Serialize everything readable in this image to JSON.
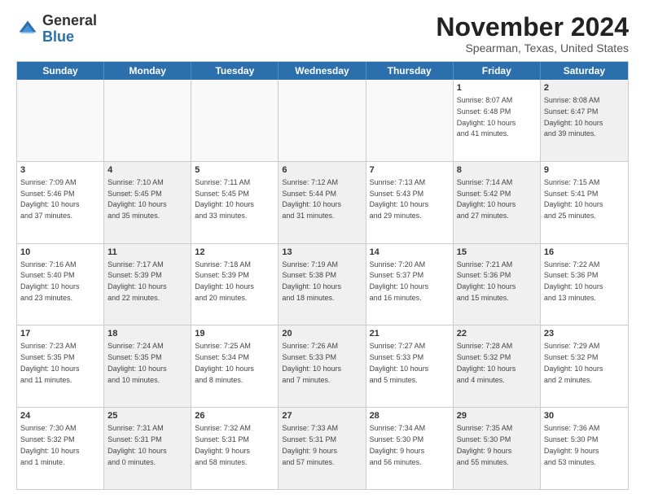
{
  "logo": {
    "line1": "General",
    "line2": "Blue"
  },
  "title": "November 2024",
  "location": "Spearman, Texas, United States",
  "header_days": [
    "Sunday",
    "Monday",
    "Tuesday",
    "Wednesday",
    "Thursday",
    "Friday",
    "Saturday"
  ],
  "weeks": [
    [
      {
        "day": "",
        "info": "",
        "shaded": false,
        "empty": true
      },
      {
        "day": "",
        "info": "",
        "shaded": false,
        "empty": true
      },
      {
        "day": "",
        "info": "",
        "shaded": false,
        "empty": true
      },
      {
        "day": "",
        "info": "",
        "shaded": false,
        "empty": true
      },
      {
        "day": "",
        "info": "",
        "shaded": false,
        "empty": true
      },
      {
        "day": "1",
        "info": "Sunrise: 8:07 AM\nSunset: 6:48 PM\nDaylight: 10 hours\nand 41 minutes.",
        "shaded": false,
        "empty": false
      },
      {
        "day": "2",
        "info": "Sunrise: 8:08 AM\nSunset: 6:47 PM\nDaylight: 10 hours\nand 39 minutes.",
        "shaded": true,
        "empty": false
      }
    ],
    [
      {
        "day": "3",
        "info": "Sunrise: 7:09 AM\nSunset: 5:46 PM\nDaylight: 10 hours\nand 37 minutes.",
        "shaded": false,
        "empty": false
      },
      {
        "day": "4",
        "info": "Sunrise: 7:10 AM\nSunset: 5:45 PM\nDaylight: 10 hours\nand 35 minutes.",
        "shaded": true,
        "empty": false
      },
      {
        "day": "5",
        "info": "Sunrise: 7:11 AM\nSunset: 5:45 PM\nDaylight: 10 hours\nand 33 minutes.",
        "shaded": false,
        "empty": false
      },
      {
        "day": "6",
        "info": "Sunrise: 7:12 AM\nSunset: 5:44 PM\nDaylight: 10 hours\nand 31 minutes.",
        "shaded": true,
        "empty": false
      },
      {
        "day": "7",
        "info": "Sunrise: 7:13 AM\nSunset: 5:43 PM\nDaylight: 10 hours\nand 29 minutes.",
        "shaded": false,
        "empty": false
      },
      {
        "day": "8",
        "info": "Sunrise: 7:14 AM\nSunset: 5:42 PM\nDaylight: 10 hours\nand 27 minutes.",
        "shaded": true,
        "empty": false
      },
      {
        "day": "9",
        "info": "Sunrise: 7:15 AM\nSunset: 5:41 PM\nDaylight: 10 hours\nand 25 minutes.",
        "shaded": false,
        "empty": false
      }
    ],
    [
      {
        "day": "10",
        "info": "Sunrise: 7:16 AM\nSunset: 5:40 PM\nDaylight: 10 hours\nand 23 minutes.",
        "shaded": false,
        "empty": false
      },
      {
        "day": "11",
        "info": "Sunrise: 7:17 AM\nSunset: 5:39 PM\nDaylight: 10 hours\nand 22 minutes.",
        "shaded": true,
        "empty": false
      },
      {
        "day": "12",
        "info": "Sunrise: 7:18 AM\nSunset: 5:39 PM\nDaylight: 10 hours\nand 20 minutes.",
        "shaded": false,
        "empty": false
      },
      {
        "day": "13",
        "info": "Sunrise: 7:19 AM\nSunset: 5:38 PM\nDaylight: 10 hours\nand 18 minutes.",
        "shaded": true,
        "empty": false
      },
      {
        "day": "14",
        "info": "Sunrise: 7:20 AM\nSunset: 5:37 PM\nDaylight: 10 hours\nand 16 minutes.",
        "shaded": false,
        "empty": false
      },
      {
        "day": "15",
        "info": "Sunrise: 7:21 AM\nSunset: 5:36 PM\nDaylight: 10 hours\nand 15 minutes.",
        "shaded": true,
        "empty": false
      },
      {
        "day": "16",
        "info": "Sunrise: 7:22 AM\nSunset: 5:36 PM\nDaylight: 10 hours\nand 13 minutes.",
        "shaded": false,
        "empty": false
      }
    ],
    [
      {
        "day": "17",
        "info": "Sunrise: 7:23 AM\nSunset: 5:35 PM\nDaylight: 10 hours\nand 11 minutes.",
        "shaded": false,
        "empty": false
      },
      {
        "day": "18",
        "info": "Sunrise: 7:24 AM\nSunset: 5:35 PM\nDaylight: 10 hours\nand 10 minutes.",
        "shaded": true,
        "empty": false
      },
      {
        "day": "19",
        "info": "Sunrise: 7:25 AM\nSunset: 5:34 PM\nDaylight: 10 hours\nand 8 minutes.",
        "shaded": false,
        "empty": false
      },
      {
        "day": "20",
        "info": "Sunrise: 7:26 AM\nSunset: 5:33 PM\nDaylight: 10 hours\nand 7 minutes.",
        "shaded": true,
        "empty": false
      },
      {
        "day": "21",
        "info": "Sunrise: 7:27 AM\nSunset: 5:33 PM\nDaylight: 10 hours\nand 5 minutes.",
        "shaded": false,
        "empty": false
      },
      {
        "day": "22",
        "info": "Sunrise: 7:28 AM\nSunset: 5:32 PM\nDaylight: 10 hours\nand 4 minutes.",
        "shaded": true,
        "empty": false
      },
      {
        "day": "23",
        "info": "Sunrise: 7:29 AM\nSunset: 5:32 PM\nDaylight: 10 hours\nand 2 minutes.",
        "shaded": false,
        "empty": false
      }
    ],
    [
      {
        "day": "24",
        "info": "Sunrise: 7:30 AM\nSunset: 5:32 PM\nDaylight: 10 hours\nand 1 minute.",
        "shaded": false,
        "empty": false
      },
      {
        "day": "25",
        "info": "Sunrise: 7:31 AM\nSunset: 5:31 PM\nDaylight: 10 hours\nand 0 minutes.",
        "shaded": true,
        "empty": false
      },
      {
        "day": "26",
        "info": "Sunrise: 7:32 AM\nSunset: 5:31 PM\nDaylight: 9 hours\nand 58 minutes.",
        "shaded": false,
        "empty": false
      },
      {
        "day": "27",
        "info": "Sunrise: 7:33 AM\nSunset: 5:31 PM\nDaylight: 9 hours\nand 57 minutes.",
        "shaded": true,
        "empty": false
      },
      {
        "day": "28",
        "info": "Sunrise: 7:34 AM\nSunset: 5:30 PM\nDaylight: 9 hours\nand 56 minutes.",
        "shaded": false,
        "empty": false
      },
      {
        "day": "29",
        "info": "Sunrise: 7:35 AM\nSunset: 5:30 PM\nDaylight: 9 hours\nand 55 minutes.",
        "shaded": true,
        "empty": false
      },
      {
        "day": "30",
        "info": "Sunrise: 7:36 AM\nSunset: 5:30 PM\nDaylight: 9 hours\nand 53 minutes.",
        "shaded": false,
        "empty": false
      }
    ]
  ]
}
